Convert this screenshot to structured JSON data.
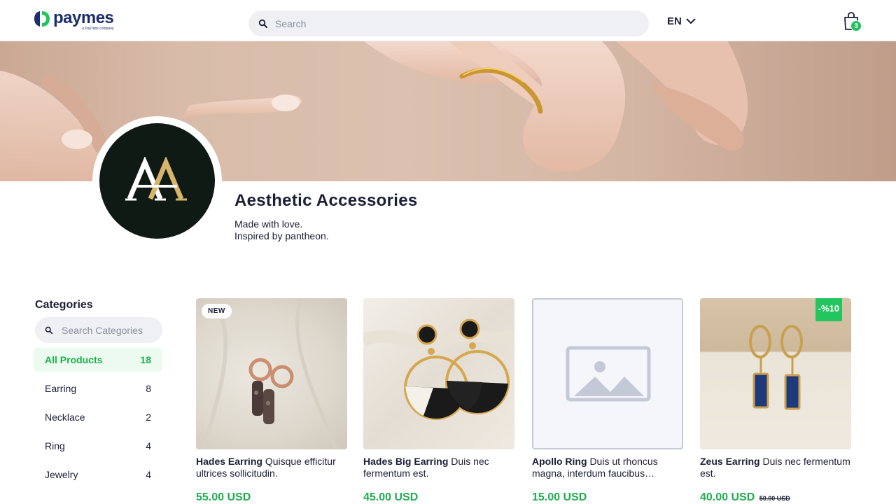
{
  "brand": {
    "name": "paymes",
    "tagline": "a PayTabs company"
  },
  "header": {
    "search_placeholder": "Search",
    "language": "EN",
    "cart_count": "3"
  },
  "store": {
    "name": "Aesthetic Accessories",
    "description_line1": "Made with love.",
    "description_line2": "Inspired by pantheon.",
    "logo_letters": "AA"
  },
  "categories": {
    "title": "Categories",
    "search_placeholder": "Search Categories",
    "items": [
      {
        "label": "All Products",
        "count": "18"
      },
      {
        "label": "Earring",
        "count": "8"
      },
      {
        "label": "Necklace",
        "count": "2"
      },
      {
        "label": "Ring",
        "count": "4"
      },
      {
        "label": "Jewelry",
        "count": "4"
      }
    ]
  },
  "products": [
    {
      "name": "Hades Earring",
      "description": "Quisque efficitur ultrices sollicitudin.",
      "price": "55.00 USD",
      "badge": "NEW"
    },
    {
      "name": "Hades Big Earring",
      "description": "Duis nec fermentum est.",
      "price": "45.00 USD"
    },
    {
      "name": "Apollo Ring",
      "description": "Duis ut rhoncus magna, interdum faucibus…",
      "price": "15.00 USD"
    },
    {
      "name": "Zeus Earring",
      "description": "Duis nec fermentum est.",
      "price": "40.00 USD",
      "old_price": "50.00 USD",
      "badge": "-%10"
    }
  ],
  "colors": {
    "accent": "#1fae4f",
    "badge_green": "#22c55e",
    "brand_navy": "#1a2e6b"
  }
}
